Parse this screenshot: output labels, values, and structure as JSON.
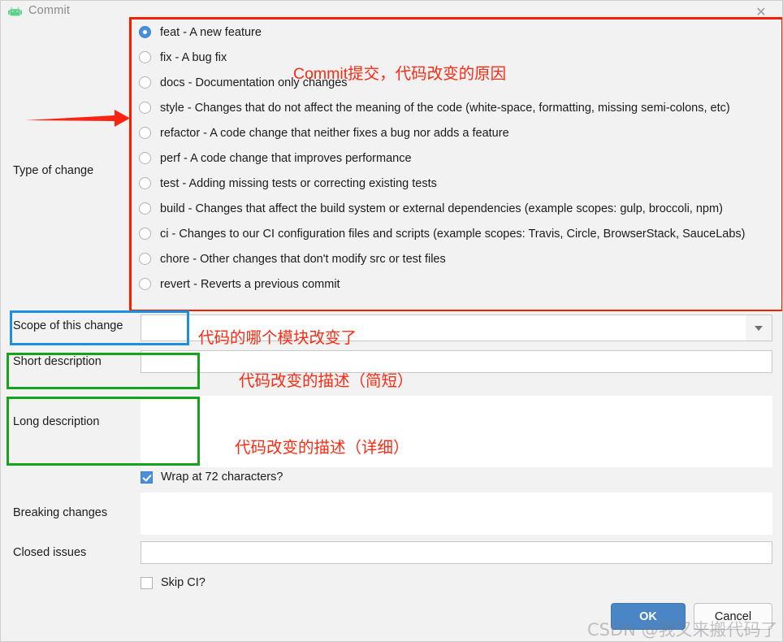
{
  "window": {
    "title": "Commit",
    "icon": "android-icon",
    "close_label": "✕"
  },
  "form": {
    "type_of_change_label": "Type of change",
    "radio_options": [
      {
        "label": "feat - A new feature",
        "selected": true
      },
      {
        "label": "fix - A bug fix",
        "selected": false
      },
      {
        "label": "docs - Documentation only changes",
        "selected": false
      },
      {
        "label": "style - Changes that do not affect the meaning of the code (white-space, formatting, missing semi-colons, etc)",
        "selected": false
      },
      {
        "label": "refactor - A code change that neither fixes a bug nor adds a feature",
        "selected": false
      },
      {
        "label": "perf - A code change that improves performance",
        "selected": false
      },
      {
        "label": "test - Adding missing tests or correcting existing tests",
        "selected": false
      },
      {
        "label": "build - Changes that affect the build system or external dependencies (example scopes: gulp, broccoli, npm)",
        "selected": false
      },
      {
        "label": "ci - Changes to our CI configuration files and scripts (example scopes: Travis, Circle, BrowserStack, SauceLabs)",
        "selected": false
      },
      {
        "label": "chore - Other changes that don't modify src or test files",
        "selected": false
      },
      {
        "label": "revert - Reverts a previous commit",
        "selected": false
      }
    ],
    "scope_label": "Scope of this change",
    "scope_value": "",
    "short_description_label": "Short description",
    "short_description_value": "",
    "long_description_label": "Long description",
    "long_description_value": "",
    "wrap_checkbox_label": "Wrap at 72 characters?",
    "wrap_checked": true,
    "breaking_changes_label": "Breaking changes",
    "breaking_changes_value": "",
    "closed_issues_label": "Closed issues",
    "closed_issues_value": "",
    "skip_ci_label": "Skip CI?",
    "skip_ci_checked": false
  },
  "buttons": {
    "ok": "OK",
    "cancel": "Cancel"
  },
  "annotations": {
    "commit_reason": "Commit提交，代码改变的原因",
    "scope_note": "代码的哪个模块改变了",
    "short_desc_note": "代码改变的描述（简短）",
    "long_desc_note": "代码改变的描述（详细）"
  },
  "watermark": {
    "text": "CSDN @我又来搬代码了"
  },
  "colors": {
    "red_box": "#f42000",
    "blue_box": "#1e8fe0",
    "green_box": "#15a31b",
    "annotation_text": "#fb2b13",
    "accent": "#4a90d9",
    "ok_button": "#4a86c5"
  }
}
